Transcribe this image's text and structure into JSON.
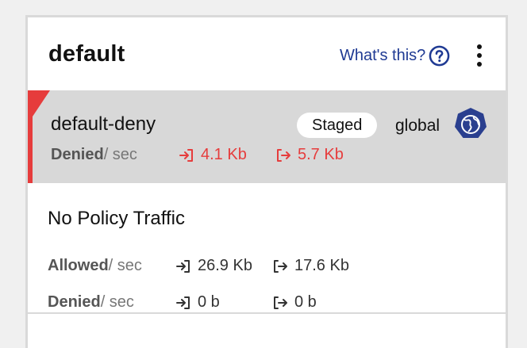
{
  "tier": {
    "title": "default",
    "help_link": "What's this?",
    "icons": {
      "help": "help-circle-icon",
      "menu": "kebab-menu-icon"
    }
  },
  "policy": {
    "name": "default-deny",
    "status_badge": "Staged",
    "scope": "global",
    "scope_icon": "globe-badge-icon",
    "metric_label": "Denied",
    "metric_unit": "/ sec",
    "inbound": "4.1 Kb",
    "outbound": "5.7 Kb",
    "accent_color": "#e63c3c",
    "row_background": "#d8d8d8"
  },
  "no_policy": {
    "title": "No Policy Traffic",
    "allowed": {
      "label": "Allowed",
      "unit": "/ sec",
      "inbound": "26.9 Kb",
      "outbound": "17.6 Kb"
    },
    "denied": {
      "label": "Denied",
      "unit": "/ sec",
      "inbound": "0 b",
      "outbound": "0 b"
    }
  },
  "colors": {
    "link": "#1f3a93",
    "danger": "#e63c3c",
    "badge_bg": "#2a3f8f"
  }
}
